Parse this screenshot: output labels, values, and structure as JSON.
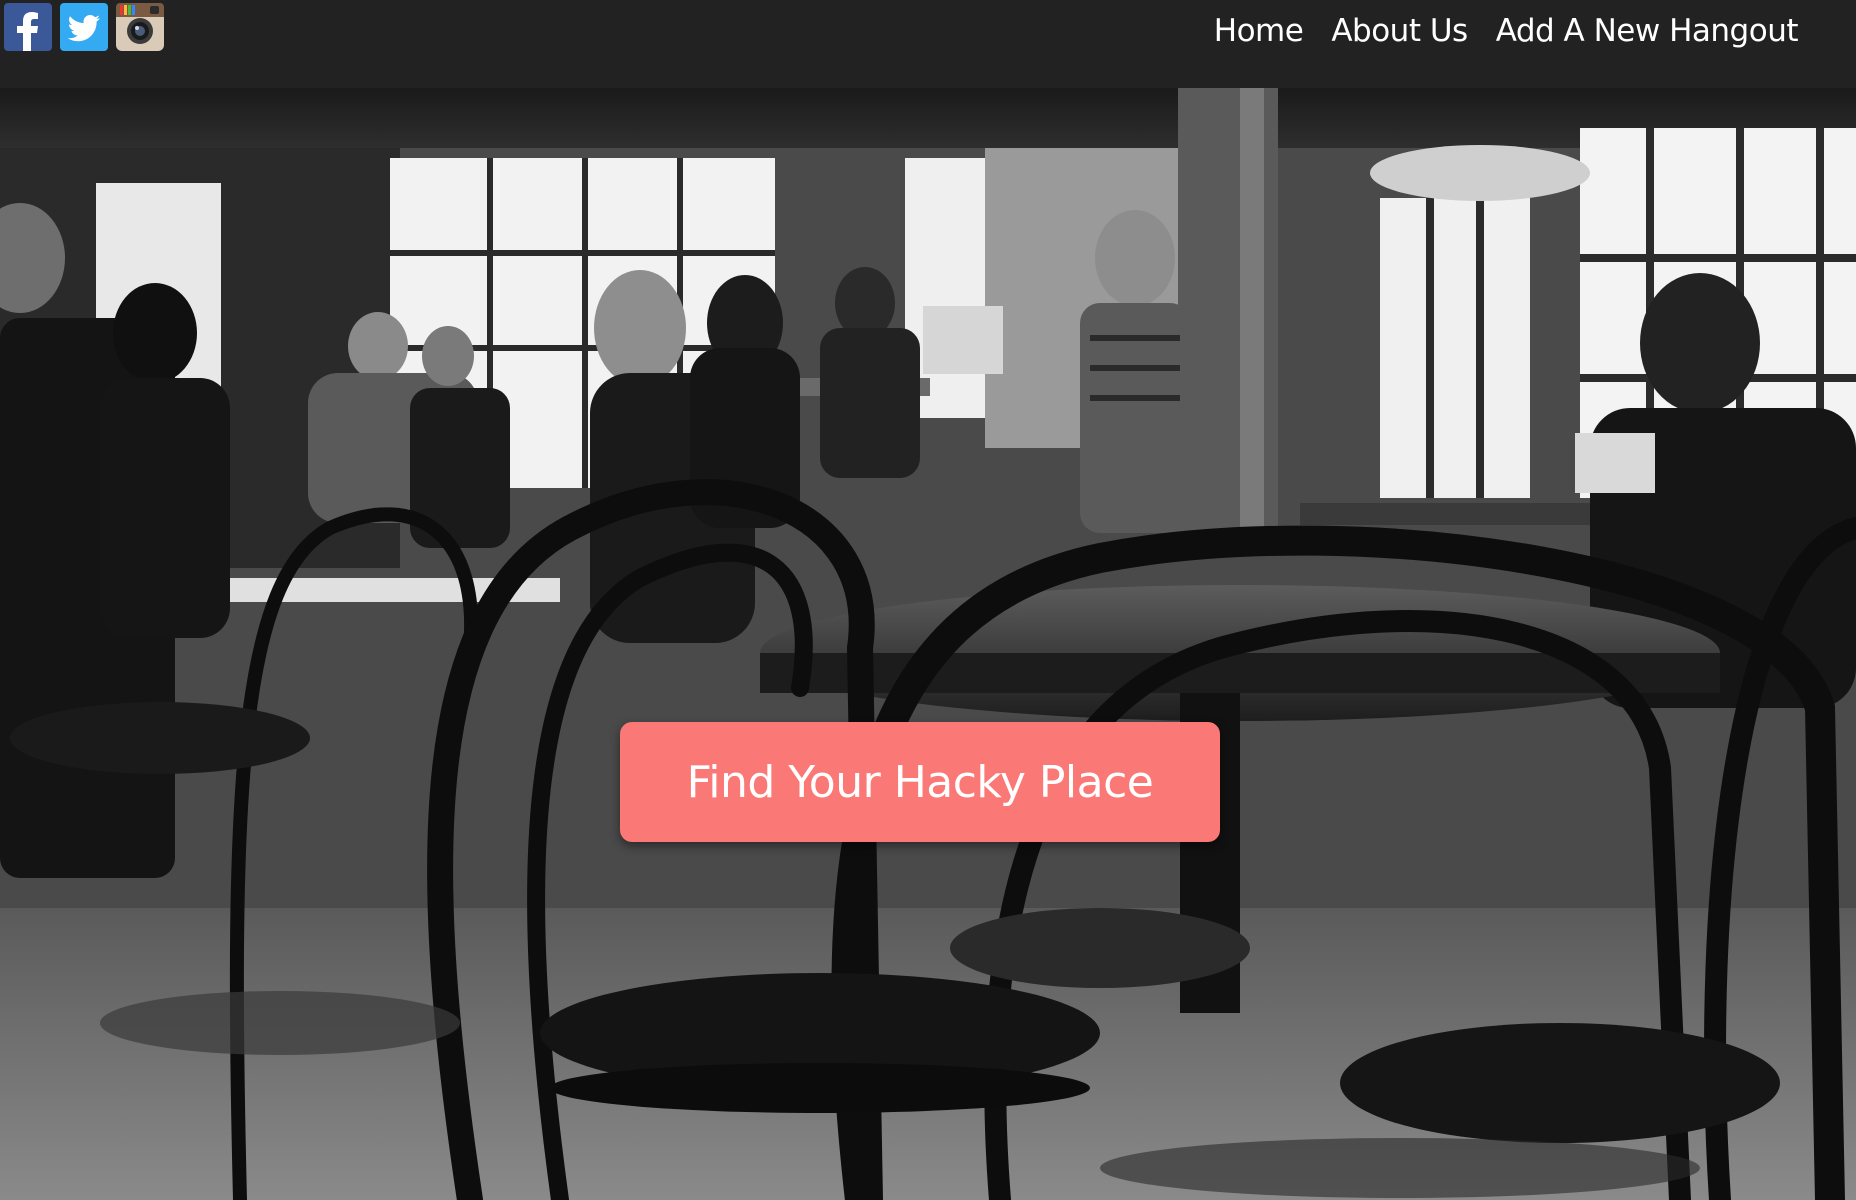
{
  "nav": {
    "social": [
      {
        "name": "facebook",
        "icon": "facebook-icon",
        "color": "#3b5998"
      },
      {
        "name": "twitter",
        "icon": "twitter-icon",
        "color": "#33aaf2"
      },
      {
        "name": "instagram",
        "icon": "instagram-icon",
        "color": "#7a5a42"
      }
    ],
    "links": {
      "home": "Home",
      "about": "About Us",
      "add_hangout": "Add A New Hangout"
    }
  },
  "hero": {
    "background": "black-and-white coffee shop interior photo",
    "cta_label": "Find Your Hacky Place",
    "cta_color": "#fa7876"
  }
}
